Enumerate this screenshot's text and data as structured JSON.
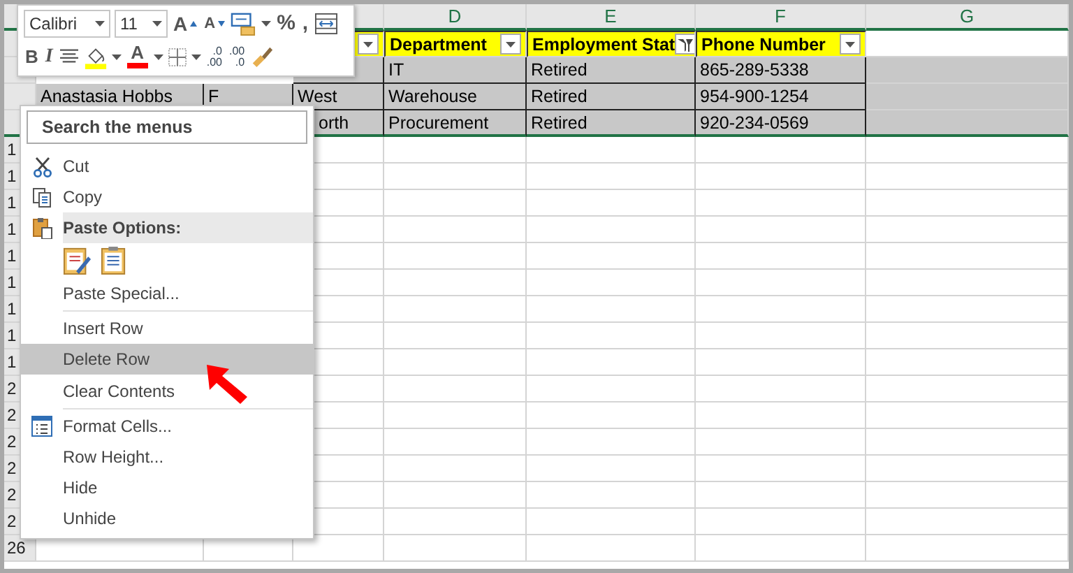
{
  "toolbar": {
    "font": "Calibri",
    "size": "11",
    "row_1": [
      {
        "kind": "grow_font",
        "glyph": "A"
      },
      {
        "kind": "shrink_font",
        "glyph": "A"
      },
      {
        "kind": "cell_styles"
      },
      {
        "kind": "dropdown"
      },
      {
        "kind": "percent",
        "glyph": "%"
      },
      {
        "kind": "comma",
        "glyph": ","
      },
      {
        "kind": "wrap"
      }
    ],
    "row_2": [
      {
        "kind": "bold",
        "glyph": "B"
      },
      {
        "kind": "italic",
        "glyph": "I"
      },
      {
        "kind": "align"
      },
      {
        "kind": "fill",
        "color": "#ffff00"
      },
      {
        "kind": "dropdown"
      },
      {
        "kind": "font_color",
        "glyph": "A",
        "color": "#ff0000"
      },
      {
        "kind": "dropdown"
      },
      {
        "kind": "borders"
      },
      {
        "kind": "dropdown"
      },
      {
        "kind": "increase_decimal",
        "glyphs": [
          ".0",
          ".00"
        ]
      },
      {
        "kind": "decrease_decimal",
        "glyphs": [
          ".00",
          ".0"
        ]
      },
      {
        "kind": "format_painter"
      }
    ]
  },
  "sheet": {
    "column_headers": [
      "D",
      "E",
      "F",
      "G"
    ],
    "table_header": [
      {
        "text": "Department",
        "filtered": false
      },
      {
        "text": "Employment Stat",
        "filtered": true
      },
      {
        "text": "Phone Number",
        "filtered": false
      }
    ],
    "rows": [
      {
        "department": "IT",
        "employment_status": "Retired",
        "phone_number": "865-289-5338"
      },
      {
        "column_a": "Anastasia Hobbs",
        "column_b": "F",
        "column_c": "West",
        "department": "Warehouse",
        "employment_status": "Retired",
        "phone_number": "954-900-1254"
      },
      {
        "column_c": "orth",
        "department": "Procurement",
        "employment_status": "Retired",
        "phone_number": "920-234-0569"
      }
    ],
    "row_numbers": [
      "1",
      "1",
      "1",
      "1",
      "1",
      "1",
      "1",
      "1",
      "1",
      "2",
      "2",
      "2",
      "2",
      "2",
      "2",
      "26"
    ]
  },
  "context_menu": {
    "search_placeholder": "Search the menus",
    "items": [
      {
        "kind": "cut",
        "label": "Cut",
        "highlighted": false
      },
      {
        "kind": "copy",
        "label": "Copy",
        "highlighted": false
      },
      {
        "kind": "paste_header",
        "label": "Paste Options:"
      },
      {
        "kind": "paste_icons"
      },
      {
        "kind": "command",
        "label": "Paste Special...",
        "highlighted": false
      },
      {
        "kind": "separator"
      },
      {
        "kind": "command",
        "label": "Insert Row",
        "highlighted": false
      },
      {
        "kind": "command",
        "label": "Delete Row",
        "highlighted": true
      },
      {
        "kind": "command",
        "label": "Clear Contents",
        "highlighted": false
      },
      {
        "kind": "separator"
      },
      {
        "kind": "format_cells",
        "label": "Format Cells...",
        "highlighted": false
      },
      {
        "kind": "command",
        "label": "Row Height...",
        "highlighted": false
      },
      {
        "kind": "command",
        "label": "Hide",
        "highlighted": false
      },
      {
        "kind": "command",
        "label": "Unhide",
        "highlighted": false
      }
    ]
  }
}
